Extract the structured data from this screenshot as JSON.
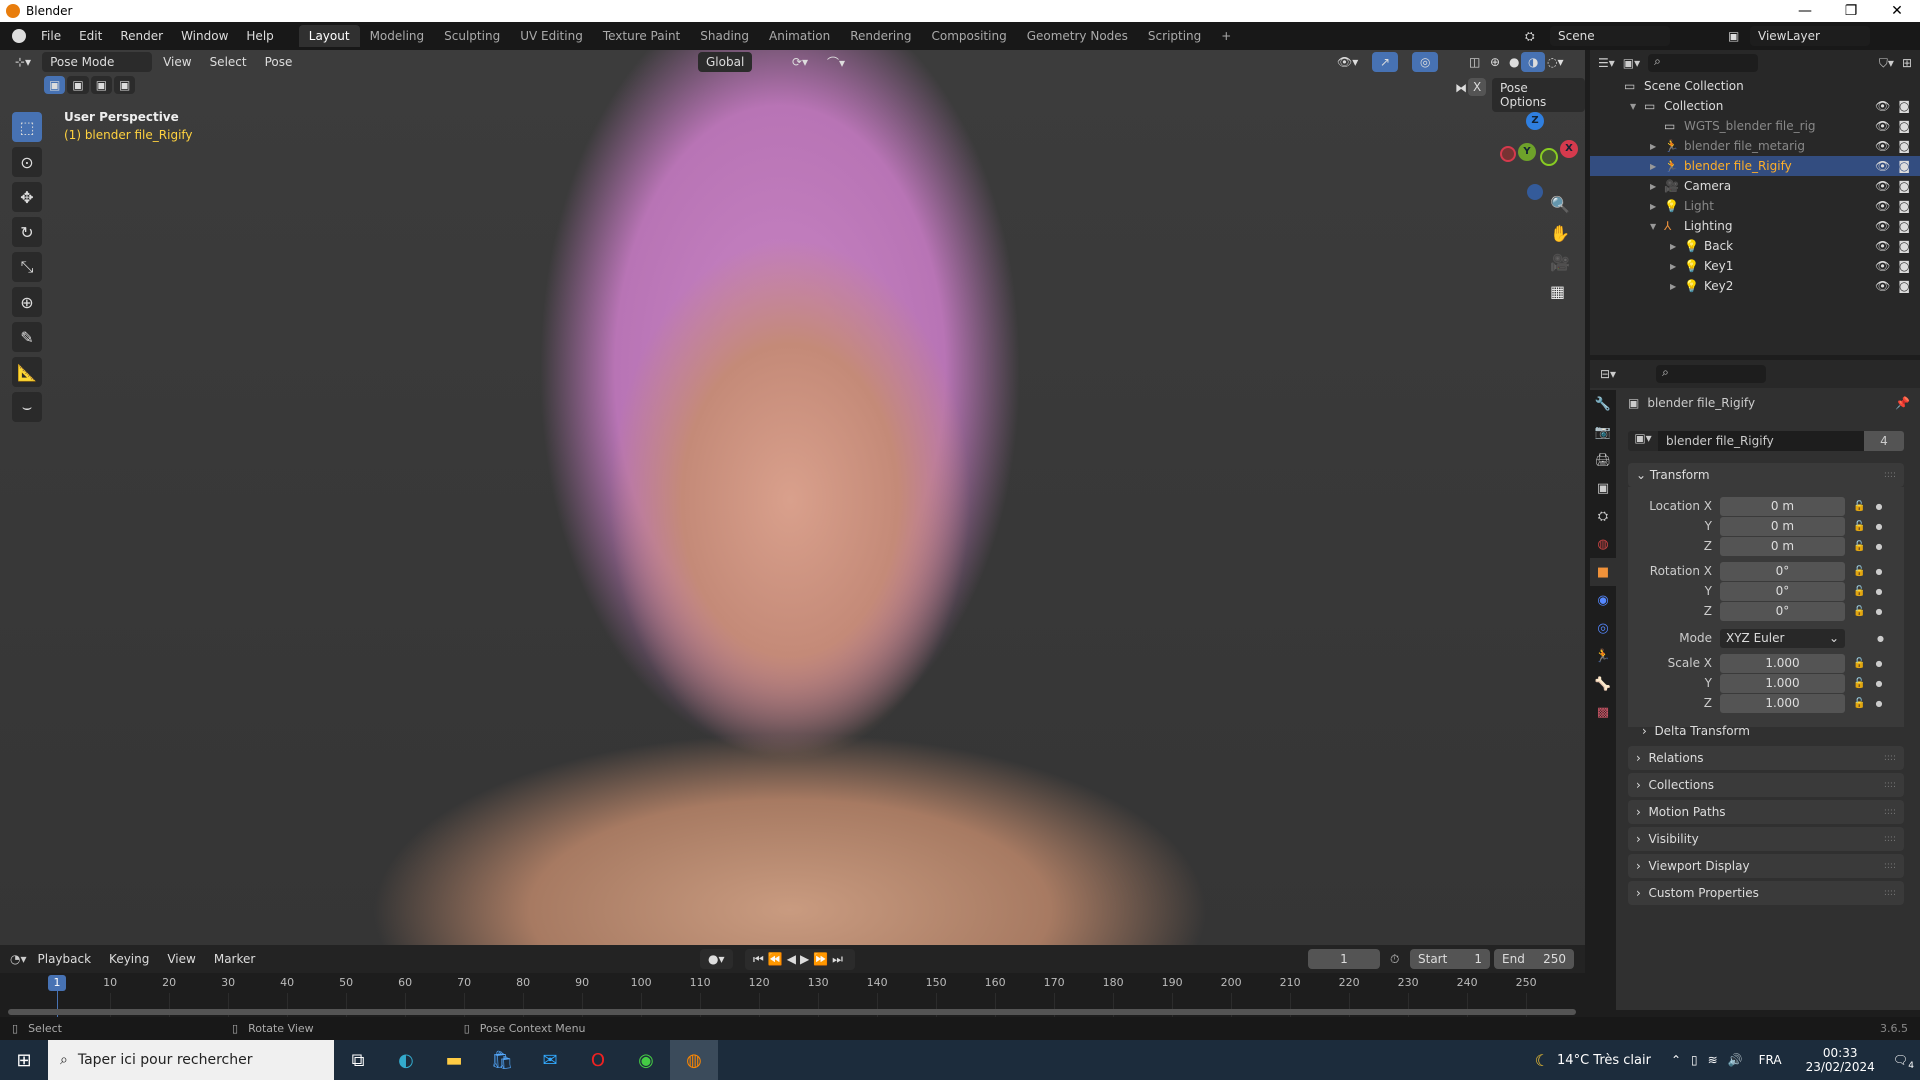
{
  "window": {
    "title": "Blender",
    "min": "—",
    "max": "❐",
    "close": "✕"
  },
  "menus": [
    "File",
    "Edit",
    "Render",
    "Window",
    "Help"
  ],
  "workspaces": [
    "Layout",
    "Modeling",
    "Sculpting",
    "UV Editing",
    "Texture Paint",
    "Shading",
    "Animation",
    "Rendering",
    "Compositing",
    "Geometry Nodes",
    "Scripting"
  ],
  "add_workspace": "+",
  "scene": "Scene",
  "view_layer": "ViewLayer",
  "viewport": {
    "mode": "Pose Mode",
    "menus": [
      "View",
      "Select",
      "Pose"
    ],
    "orientation": "Global",
    "pose_options": "Pose Options",
    "x_mirror": "X",
    "overlay_title": "User Perspective",
    "overlay_object": "(1) blender file_Rigify",
    "gizmo": {
      "x": "X",
      "y": "Y",
      "z": "Z"
    }
  },
  "outliner": {
    "items": [
      {
        "name": "Scene Collection",
        "depth": 0,
        "state": "normal"
      },
      {
        "name": "Collection",
        "depth": 1,
        "state": "normal"
      },
      {
        "name": "WGTS_blender file_rig",
        "depth": 2,
        "state": "dim"
      },
      {
        "name": "blender file_metarig",
        "depth": 2,
        "state": "dim"
      },
      {
        "name": "blender file_Rigify",
        "depth": 2,
        "state": "selected"
      },
      {
        "name": "Camera",
        "depth": 2,
        "state": "normal"
      },
      {
        "name": "Light",
        "depth": 2,
        "state": "dim"
      },
      {
        "name": "Lighting",
        "depth": 2,
        "state": "normal"
      },
      {
        "name": "Back",
        "depth": 3,
        "state": "normal"
      },
      {
        "name": "Key1",
        "depth": 3,
        "state": "normal"
      },
      {
        "name": "Key2",
        "depth": 3,
        "state": "normal"
      }
    ]
  },
  "properties": {
    "object_name": "blender file_Rigify",
    "data_name": "blender file_Rigify",
    "users": "4",
    "transform_label": "Transform",
    "location": {
      "label": "Location X",
      "x": "0 m",
      "y": "0 m",
      "z": "0 m"
    },
    "rotation": {
      "label": "Rotation X",
      "x": "0°",
      "y": "0°",
      "z": "0°"
    },
    "mode_label": "Mode",
    "mode": "XYZ Euler",
    "scale": {
      "label": "Scale X",
      "x": "1.000",
      "y": "1.000",
      "z": "1.000"
    },
    "axis_y": "Y",
    "axis_z": "Z",
    "delta": "Delta Transform",
    "panels": [
      "Relations",
      "Collections",
      "Motion Paths",
      "Visibility",
      "Viewport Display",
      "Custom Properties"
    ]
  },
  "timeline": {
    "menus": [
      "Playback",
      "Keying",
      "View",
      "Marker"
    ],
    "current_frame": "1",
    "start_label": "Start",
    "start": "1",
    "end_label": "End",
    "end": "250",
    "ticks": [
      "10",
      "20",
      "30",
      "40",
      "50",
      "60",
      "70",
      "80",
      "90",
      "100",
      "110",
      "120",
      "130",
      "140",
      "150",
      "160",
      "170",
      "180",
      "190",
      "200",
      "210",
      "220",
      "230",
      "240",
      "250"
    ]
  },
  "status": {
    "select": "Select",
    "rotate": "Rotate View",
    "context": "Pose Context Menu",
    "version": "3.6.5"
  },
  "taskbar": {
    "search": "Taper ici pour rechercher",
    "weather": "14°C  Très clair",
    "lang": "FRA",
    "time": "00:33",
    "date": "23/02/2024",
    "notifications": "4"
  }
}
